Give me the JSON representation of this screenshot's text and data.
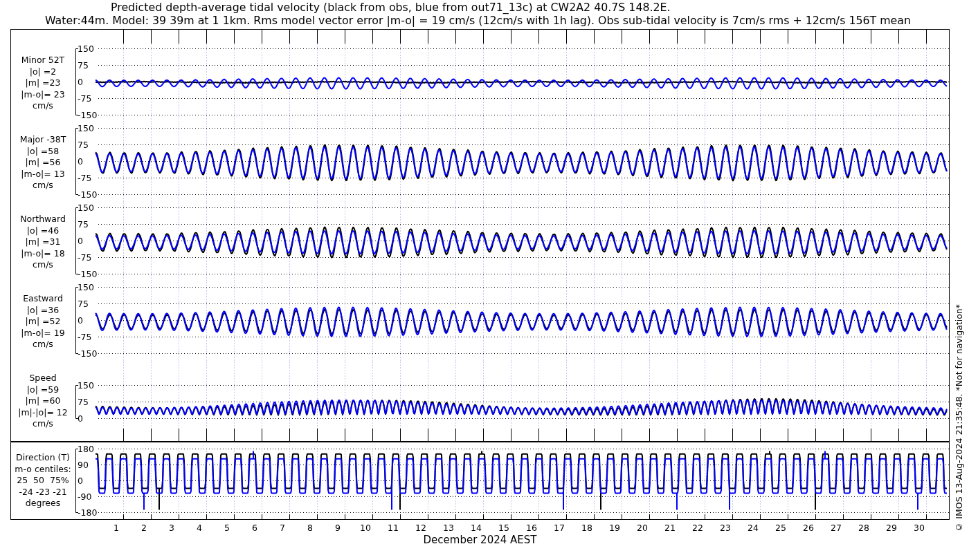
{
  "title": [
    "Predicted depth-average tidal velocity (black from obs, blue from out71_13c) at CW2A2 40.7S 148.2E.",
    "Water:44m. Model: 39 39m at 1 1km. Rms model vector error |m-o| = 19 cm/s (12cm/s with 1h lag). Obs sub-tidal velocity is 7cm/s rms + 12cm/s 156T mean"
  ],
  "panels": [
    {
      "kind": "velocity",
      "label": [
        "Minor 52T",
        "|o| =2",
        "|m| =23",
        "|m-o|= 23",
        "cm/s"
      ],
      "yticks": [
        "150",
        "75",
        "0",
        "-75",
        "-150"
      ]
    },
    {
      "kind": "velocity",
      "label": [
        "Major -38T",
        "|o| =58",
        "|m| =56",
        "|m-o|= 13",
        "cm/s"
      ],
      "yticks": [
        "150",
        "75",
        "0",
        "-75",
        "-150"
      ]
    },
    {
      "kind": "velocity",
      "label": [
        "Northward",
        "|o| =46",
        "|m| =31",
        "|m-o|= 18",
        "cm/s"
      ],
      "yticks": [
        "150",
        "75",
        "0",
        "-75",
        "-150"
      ]
    },
    {
      "kind": "velocity",
      "label": [
        "Eastward",
        "|o| =36",
        "|m| =52",
        "|m-o|= 19",
        "cm/s"
      ],
      "yticks": [
        "150",
        "75",
        "0",
        "-75",
        "-150"
      ]
    },
    {
      "kind": "speed",
      "label": [
        "Speed",
        "|o| =59",
        "|m| =60",
        "|m|-|o|= 12",
        "cm/s"
      ],
      "yticks": [
        "150",
        "75",
        "0"
      ]
    },
    {
      "kind": "direction",
      "label": [
        "Direction (T)",
        "m-o centiles:",
        "25  50  75%",
        "-24 -23 -21",
        "degrees"
      ],
      "yticks": [
        "180",
        "90",
        "0",
        "-90",
        "-180"
      ]
    }
  ],
  "x_axis": {
    "ticks": [
      "1",
      "2",
      "3",
      "4",
      "5",
      "6",
      "7",
      "8",
      "9",
      "10",
      "11",
      "12",
      "13",
      "14",
      "15",
      "16",
      "17",
      "18",
      "19",
      "20",
      "21",
      "22",
      "23",
      "24",
      "25",
      "26",
      "27",
      "28",
      "29",
      "30"
    ],
    "label": "December 2024 AEST"
  },
  "credit": "© IMOS 13-Aug-2024 21:35:48. *Not for navigation*"
}
